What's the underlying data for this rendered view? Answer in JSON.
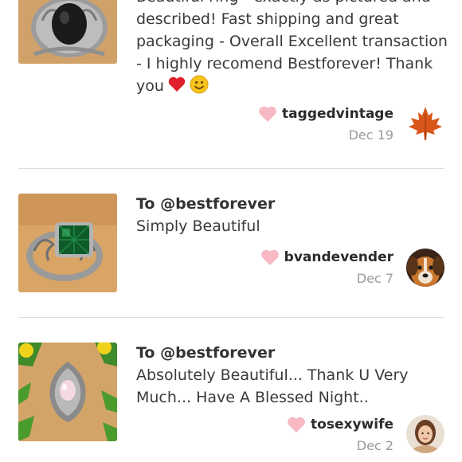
{
  "reviews": [
    {
      "recipient": "",
      "comment": "Beautiful ring - exactly as pictured and described! Fast shipping and great packaging - Overall Excellent transaction - I highly recomend Bestforever! Thank you",
      "username": "taggedvintage",
      "date": "Dec 19",
      "image_icon": "black-onyx-ring",
      "avatar_icon": "maple-leaf-icon"
    },
    {
      "recipient": "To @bestforever",
      "comment": "Simply Beautiful",
      "username": "bvandevender",
      "date": "Dec 7",
      "image_icon": "green-stone-ring",
      "avatar_icon": "dog-avatar"
    },
    {
      "recipient": "To @bestforever",
      "comment": "Absolutely Beautiful... Thank U Very Much... Have A Blessed Night..",
      "username": "tosexywife",
      "date": "Dec 2",
      "image_icon": "marcasite-pendant",
      "avatar_icon": "woman-avatar"
    }
  ],
  "colors": {
    "heart": "#f7b9c3",
    "divider": "#dcdcdc",
    "date": "#9a9a9a"
  }
}
